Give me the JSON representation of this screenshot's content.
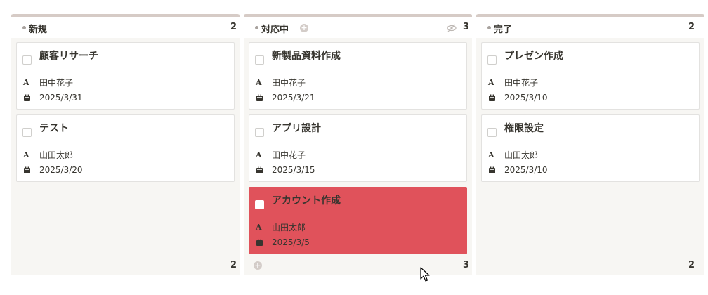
{
  "columns": [
    {
      "title": "新規",
      "count": "2",
      "footer_count": "2",
      "cards": [
        {
          "title": "顧客リサーチ",
          "person": "田中花子",
          "date": "2025/3/31"
        },
        {
          "title": "テスト",
          "person": "山田太郎",
          "date": "2025/3/20"
        }
      ]
    },
    {
      "title": "対応中",
      "count": "3",
      "footer_count": "3",
      "cards": [
        {
          "title": "新製品資料作成",
          "person": "田中花子",
          "date": "2025/3/21"
        },
        {
          "title": "アプリ設計",
          "person": "田中花子",
          "date": "2025/3/15"
        },
        {
          "title": "アカウント作成",
          "person": "山田太郎",
          "date": "2025/3/5"
        }
      ]
    },
    {
      "title": "完了",
      "count": "2",
      "footer_count": "2",
      "cards": [
        {
          "title": "プレゼン作成",
          "person": "田中花子",
          "date": "2025/3/10"
        },
        {
          "title": "権限設定",
          "person": "山田太郎",
          "date": "2025/3/10"
        }
      ]
    }
  ],
  "icons": {
    "person": "A",
    "add": "+",
    "date": "calendar-icon",
    "hidden": "eye-off-icon"
  },
  "colors": {
    "active_card": "#e0525b",
    "column_bg": "#f7f6f3",
    "column_bar": "#d6cbc6"
  }
}
